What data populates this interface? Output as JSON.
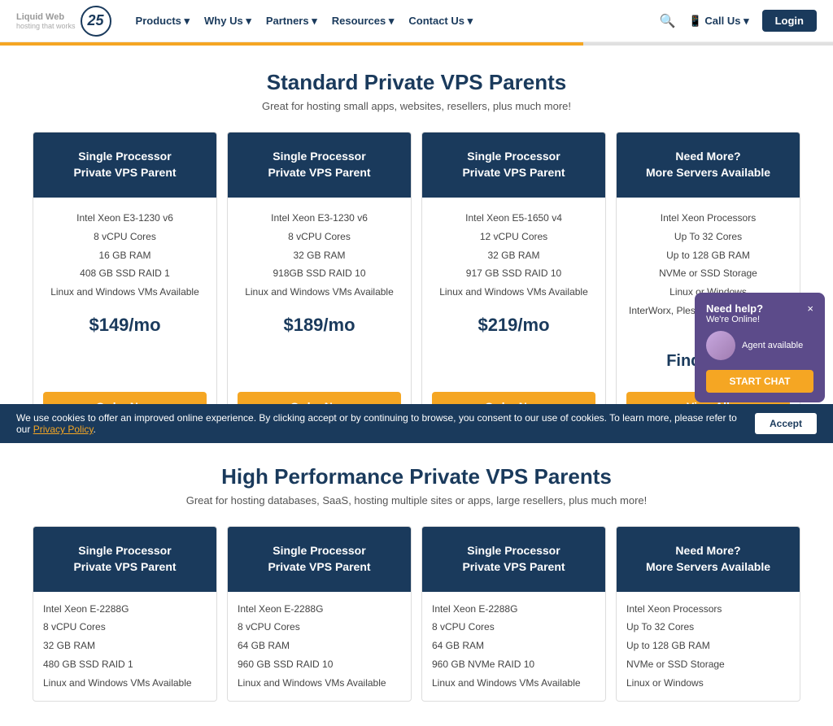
{
  "nav": {
    "logo_text": "Liquid Web",
    "logo_years": "25",
    "links": [
      {
        "label": "Products",
        "has_arrow": true
      },
      {
        "label": "Why Us",
        "has_arrow": true
      },
      {
        "label": "Partners",
        "has_arrow": true
      },
      {
        "label": "Resources",
        "has_arrow": true
      },
      {
        "label": "Contact Us",
        "has_arrow": true
      }
    ],
    "call_label": "Call Us",
    "login_label": "Login"
  },
  "standard_section": {
    "title": "Standard Private VPS Parents",
    "subtitle": "Great for hosting small apps, websites, resellers, plus much more!",
    "cards": [
      {
        "header": "Single Processor\nPrivate VPS Parent",
        "specs": [
          "Intel Xeon E3-1230 v6",
          "8 vCPU Cores",
          "16 GB RAM",
          "408 GB SSD RAID 1",
          "Linux and Windows VMs Available"
        ],
        "price": "$149/mo",
        "button": "Order Now",
        "type": "order"
      },
      {
        "header": "Single Processor\nPrivate VPS Parent",
        "specs": [
          "Intel Xeon E3-1230 v6",
          "8 vCPU Cores",
          "32 GB RAM",
          "918GB SSD RAID 10",
          "Linux and Windows VMs Available"
        ],
        "price": "$189/mo",
        "button": "Order Now",
        "type": "order"
      },
      {
        "header": "Single Processor\nPrivate VPS Parent",
        "specs": [
          "Intel Xeon E5-1650 v4",
          "12 vCPU Cores",
          "32 GB RAM",
          "917 GB SSD RAID 10",
          "Linux and Windows VMs Available"
        ],
        "price": "$219/mo",
        "button": "Order Now",
        "type": "order"
      },
      {
        "header": "Need More?\nMore Servers Available",
        "specs": [
          "Intel Xeon Processors",
          "Up To 32 Cores",
          "Up to 128 GB RAM",
          "NVMe or SSD Storage",
          "Linux or Windows",
          "InterWorx, Plesk Web Pro, or cPanel Pro"
        ],
        "price": "Find Yours",
        "button": "View All",
        "type": "view"
      }
    ]
  },
  "hp_section": {
    "title": "High Performance Private VPS Parents",
    "subtitle": "Great for hosting databases, SaaS, hosting multiple sites or apps, large resellers, plus much more!",
    "cards": [
      {
        "header": "Single Processor\nPrivate VPS Parent",
        "specs": [
          "Intel Xeon E-2288G",
          "8 vCPU Cores",
          "32 GB RAM",
          "480 GB SSD RAID 1",
          "Linux and Windows VMs Available"
        ],
        "type": "order"
      },
      {
        "header": "Single Processor\nPrivate VPS Parent",
        "specs": [
          "Intel Xeon E-2288G",
          "8 vCPU Cores",
          "64 GB RAM",
          "960 GB SSD RAID 10",
          "Linux and Windows VMs Available"
        ],
        "type": "order"
      },
      {
        "header": "Single Processor\nPrivate VPS Parent",
        "specs": [
          "Intel Xeon E-2288G",
          "8 vCPU Cores",
          "64 GB RAM",
          "960 GB NVMe RAID 10",
          "Linux and Windows VMs Available"
        ],
        "type": "order"
      },
      {
        "header": "Need More?\nMore Servers Available",
        "specs": [
          "Intel Xeon Processors",
          "Up To 32 Cores",
          "Up to 128 GB RAM",
          "NVMe or SSD Storage",
          "Linux or Windows"
        ],
        "type": "view"
      }
    ]
  },
  "chat": {
    "title": "Need help?",
    "subtitle": "We're Online!",
    "button": "START CHAT",
    "close": "×"
  },
  "cookie": {
    "text": "We use cookies to offer an improved online experience. By clicking accept or by continuing to browse, you consent to our use of cookies. To learn more, please refer to our ",
    "link_text": "Privacy Policy",
    "button": "Accept"
  }
}
